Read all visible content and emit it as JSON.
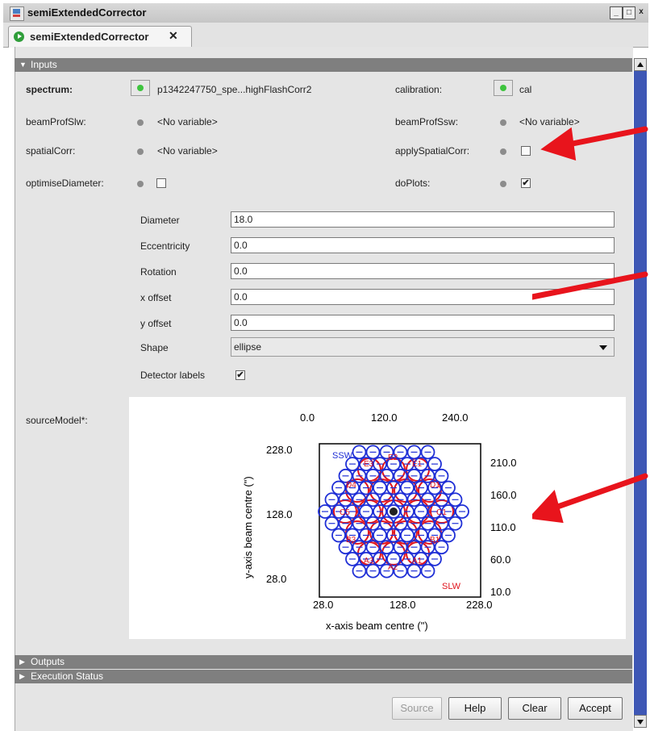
{
  "window": {
    "title": "semiExtendedCorrector",
    "min": "_",
    "max": "□",
    "close": "x"
  },
  "tab": {
    "label": "semiExtendedCorrector",
    "close": "✕"
  },
  "sections": {
    "inputs": "Inputs",
    "outputs": "Outputs",
    "execution": "Execution Status"
  },
  "inputs": {
    "spectrum": {
      "label": "spectrum:",
      "value": "p1342247750_spe...highFlashCorr2"
    },
    "calibration": {
      "label": "calibration:",
      "value": "cal"
    },
    "beamProfSlw": {
      "label": "beamProfSlw:",
      "value": "<No variable>"
    },
    "beamProfSsw": {
      "label": "beamProfSsw:",
      "value": "<No variable>"
    },
    "spatialCorr": {
      "label": "spatialCorr:",
      "value": "<No variable>"
    },
    "applySpatialCorr": {
      "label": "applySpatialCorr:",
      "checked": false
    },
    "optimiseDiameter": {
      "label": "optimiseDiameter:",
      "checked": false
    },
    "doPlots": {
      "label": "doPlots:",
      "checked": true
    }
  },
  "model_fields": {
    "diameter": {
      "label": "Diameter",
      "value": "18.0"
    },
    "eccentricity": {
      "label": "Eccentricity",
      "value": "0.0"
    },
    "rotation": {
      "label": "Rotation",
      "value": "0.0"
    },
    "x_offset": {
      "label": "x offset",
      "value": "0.0"
    },
    "y_offset": {
      "label": "y offset",
      "value": "0.0"
    },
    "shape": {
      "label": "Shape",
      "value": "ellipse"
    },
    "detector_labels": {
      "label": "Detector labels",
      "checked": true
    }
  },
  "source_model": {
    "label": "sourceModel*:"
  },
  "chart_data": {
    "type": "scatter",
    "xlabel": "x-axis beam centre (\")",
    "ylabel": "y-axis beam centre (\")",
    "bottom_ticks": [
      "28.0",
      "128.0",
      "228.0"
    ],
    "top_ticks": [
      "0.0",
      "120.0",
      "240.0"
    ],
    "left_ticks": [
      "228.0",
      "128.0",
      "28.0"
    ],
    "right_ticks": [
      "210.0",
      "160.0",
      "110.0",
      "60.0",
      "10.0"
    ],
    "series": [
      {
        "name": "SSW",
        "color": "#1f2fd6"
      },
      {
        "name": "SLW",
        "color": "#e0141c"
      }
    ],
    "red_labels": [
      "E3",
      "E2",
      "E1",
      "D4",
      "D1",
      "C5",
      "C1",
      "B3",
      "B1",
      "A3",
      "A2",
      "A1"
    ],
    "source_color": "#222222"
  },
  "buttons": {
    "source": "Source",
    "help": "Help",
    "clear": "Clear",
    "accept": "Accept"
  },
  "colors": {
    "section_bar": "#7f7f7f",
    "scrollbar": "#3e57b5",
    "led_on": "#3ec43e"
  }
}
